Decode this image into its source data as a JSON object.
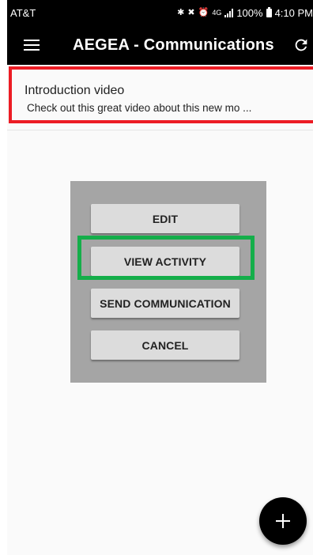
{
  "status_bar": {
    "carrier": "AT&T",
    "battery": "100%",
    "time": "4:10 PM",
    "icons": [
      "bluetooth-icon",
      "mute-icon",
      "alarm-icon",
      "lte-icon",
      "signal-icon",
      "battery-icon"
    ]
  },
  "app_bar": {
    "title": "AEGEA - Communications",
    "menu_icon": "hamburger-menu-icon",
    "refresh_icon": "refresh-icon"
  },
  "list": {
    "items": [
      {
        "title": "Introduction video",
        "subtitle": "Check out this great video about this new mo ..."
      }
    ]
  },
  "dialog": {
    "buttons": [
      "EDIT",
      "VIEW ACTIVITY",
      "SEND COMMUNICATION",
      "CANCEL"
    ]
  },
  "fab": {
    "icon": "plus-icon"
  },
  "colors": {
    "app_bar": "#000000",
    "highlight_red": "#ec1c24",
    "highlight_green": "#14ae4a",
    "dialog_bg": "#a5a5a5",
    "button_bg": "#dcdcdc"
  }
}
